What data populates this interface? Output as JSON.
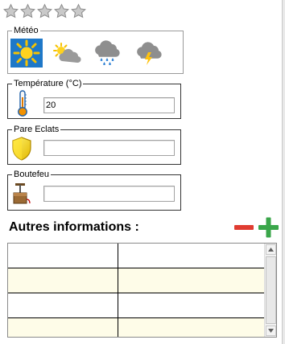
{
  "rating": {
    "stars_total": 5,
    "stars_filled": 0
  },
  "meteo": {
    "label": "Météo",
    "options": [
      "sunny-icon",
      "partly-cloudy-icon",
      "rain-icon",
      "storm-icon"
    ],
    "selected_index": 0,
    "selected_color": "#1e78c8"
  },
  "temperature": {
    "label": "Température (°C)",
    "value": "20"
  },
  "pare_eclats": {
    "label": "Pare Eclats",
    "value": ""
  },
  "boutefeu": {
    "label": "Boutefeu",
    "value": ""
  },
  "autres": {
    "title": "Autres informations :",
    "remove_color": "#e03c31",
    "add_color": "#3aa64a",
    "rows": [
      [
        "",
        ""
      ],
      [
        "",
        ""
      ],
      [
        "",
        ""
      ],
      [
        "",
        ""
      ]
    ]
  }
}
